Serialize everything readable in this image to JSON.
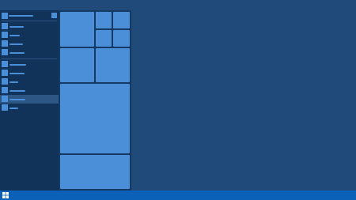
{
  "colors": {
    "desktop": "#1f4a7a",
    "menu_left": "#11335a",
    "menu_right": "#153a63",
    "accent": "#4b8fd9",
    "separator": "#2c5584",
    "selected_row": "#2d5684",
    "taskbar": "#0b60b8",
    "start_icon": "#ffffff"
  },
  "start_menu": {
    "header": {
      "icon": "user-icon",
      "action_icon": "power-icon"
    },
    "pinned_items": [
      {
        "icon": "app-icon"
      },
      {
        "icon": "app-icon"
      },
      {
        "icon": "app-icon"
      },
      {
        "icon": "app-icon"
      }
    ],
    "recent_items": [
      {
        "icon": "app-icon"
      },
      {
        "icon": "app-icon"
      },
      {
        "icon": "app-icon"
      },
      {
        "icon": "app-icon"
      },
      {
        "icon": "app-icon",
        "selected": true
      },
      {
        "icon": "app-icon"
      }
    ],
    "tiles": [
      {
        "name": "tile-large-1"
      },
      {
        "name": "tile-small-1"
      },
      {
        "name": "tile-small-2"
      },
      {
        "name": "tile-small-3"
      },
      {
        "name": "tile-small-4"
      },
      {
        "name": "tile-medium-1"
      },
      {
        "name": "tile-medium-2"
      },
      {
        "name": "tile-wide-tall"
      },
      {
        "name": "tile-wide-bottom"
      }
    ]
  },
  "taskbar": {
    "start_icon": "windows-logo-icon"
  }
}
